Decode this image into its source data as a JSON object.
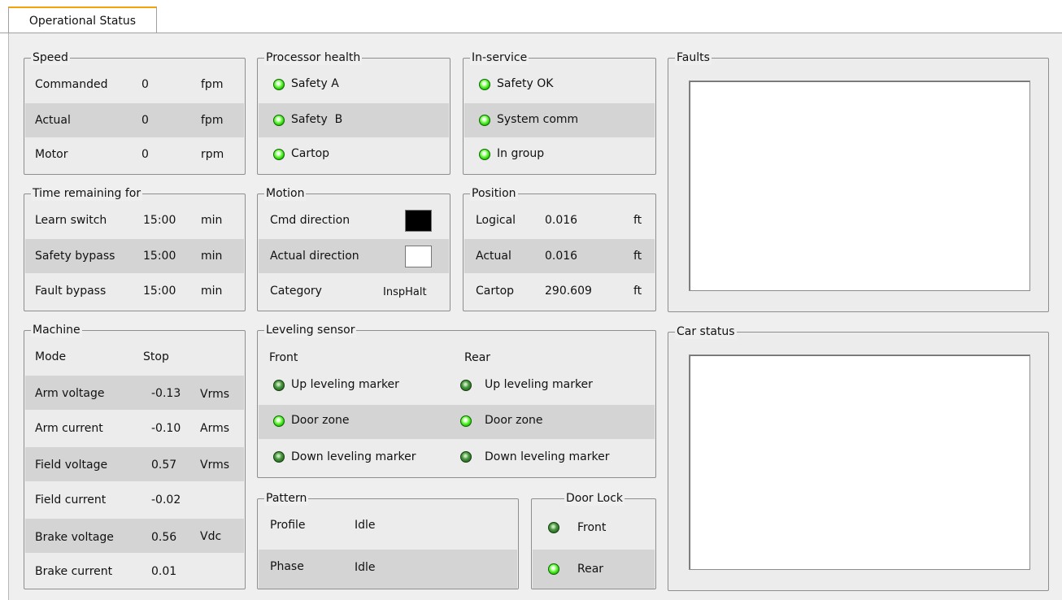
{
  "tabs": {
    "active": "Operational Status"
  },
  "speed": {
    "title": "Speed",
    "rows": [
      {
        "label": "Commanded",
        "value": "0",
        "unit": "fpm"
      },
      {
        "label": "Actual",
        "value": "0",
        "unit": "fpm"
      },
      {
        "label": "Motor",
        "value": "0",
        "unit": "rpm"
      }
    ]
  },
  "processor_health": {
    "title": "Processor health",
    "items": [
      {
        "label": "Safety A",
        "state": "on"
      },
      {
        "label": "Safety  B",
        "state": "on"
      },
      {
        "label": "Cartop",
        "state": "on"
      }
    ]
  },
  "in_service": {
    "title": "In-service",
    "items": [
      {
        "label": "Safety OK",
        "state": "on"
      },
      {
        "label": "System comm",
        "state": "on"
      },
      {
        "label": "In group",
        "state": "on"
      }
    ]
  },
  "faults": {
    "title": "Faults"
  },
  "time_remaining": {
    "title": "Time remaining for",
    "rows": [
      {
        "label": "Learn switch",
        "value": "15:00",
        "unit": "min"
      },
      {
        "label": "Safety bypass",
        "value": "15:00",
        "unit": "min"
      },
      {
        "label": "Fault bypass",
        "value": "15:00",
        "unit": "min"
      }
    ]
  },
  "motion": {
    "title": "Motion",
    "cmd_direction": {
      "label": "Cmd direction",
      "color": "#000000"
    },
    "actual_direction": {
      "label": "Actual direction",
      "color": "#ffffff"
    },
    "category": {
      "label": "Category",
      "value": "InspHalt"
    }
  },
  "position": {
    "title": "Position",
    "rows": [
      {
        "label": "Logical",
        "value": "0.016",
        "unit": "ft"
      },
      {
        "label": "Actual",
        "value": "0.016",
        "unit": "ft"
      },
      {
        "label": "Cartop",
        "value": "290.609",
        "unit": "ft"
      }
    ]
  },
  "machine": {
    "title": "Machine",
    "rows": [
      {
        "label": "Mode",
        "value": "Stop",
        "unit": ""
      },
      {
        "label": "Arm voltage",
        "value": "-0.13",
        "unit": "Vrms"
      },
      {
        "label": "Arm current",
        "value": "-0.10",
        "unit": "Arms"
      },
      {
        "label": "Field voltage",
        "value": "0.57",
        "unit": "Vrms"
      },
      {
        "label": "Field current",
        "value": "-0.02",
        "unit": ""
      },
      {
        "label": "Brake voltage",
        "value": "0.56",
        "unit": "Vdc"
      },
      {
        "label": "Brake current",
        "value": "0.01",
        "unit": ""
      }
    ]
  },
  "leveling_sensor": {
    "title": "Leveling sensor",
    "front_header": "Front",
    "rear_header": "Rear",
    "front": [
      {
        "label": "Up leveling marker",
        "state": "off"
      },
      {
        "label": "Door zone",
        "state": "on"
      },
      {
        "label": "Down leveling marker",
        "state": "off"
      }
    ],
    "rear": [
      {
        "label": "Up leveling marker",
        "state": "off"
      },
      {
        "label": "Door zone",
        "state": "on"
      },
      {
        "label": "Down leveling marker",
        "state": "off"
      }
    ]
  },
  "pattern": {
    "title": "Pattern",
    "rows": [
      {
        "label": "Profile",
        "value": "Idle"
      },
      {
        "label": "Phase",
        "value": "Idle"
      }
    ]
  },
  "door_lock": {
    "title": "Door Lock",
    "items": [
      {
        "label": "Front",
        "state": "off"
      },
      {
        "label": "Rear",
        "state": "on"
      }
    ]
  },
  "car_status": {
    "title": "Car status"
  }
}
